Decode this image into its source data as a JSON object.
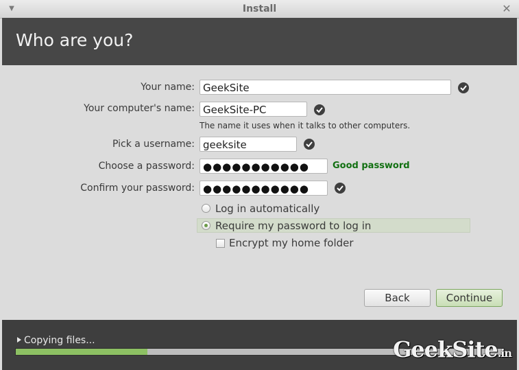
{
  "window": {
    "title": "Install"
  },
  "header": {
    "title": "Who are you?"
  },
  "form": {
    "name_label": "Your name:",
    "name_value": "GeekSite",
    "computer_label": "Your computer's name:",
    "computer_value": "GeekSite-PC",
    "computer_hint": "The name it uses when it talks to other computers.",
    "username_label": "Pick a username:",
    "username_value": "geeksite",
    "password_label": "Choose a password:",
    "password_value": "●●●●●●●●●●●",
    "password_strength": "Good password",
    "confirm_label": "Confirm your password:",
    "confirm_value": "●●●●●●●●●●●",
    "login_auto_label": "Log in automatically",
    "require_password_label": "Require my password to log in",
    "encrypt_label": "Encrypt my home folder",
    "selected_login_option": "require_password",
    "encrypt_checked": false
  },
  "buttons": {
    "back": "Back",
    "continue": "Continue"
  },
  "footer": {
    "status": "Copying files...",
    "progress": 0.27
  },
  "watermark": {
    "text": "GeekSite",
    "suffix": ".in"
  },
  "colors": {
    "header_bg": "#474747",
    "strength_green": "#127012",
    "progress_green": "#8dc063",
    "continue_green": "#c9deb6"
  },
  "icons": {
    "field_ok": "check-circle-icon",
    "window_menu": "chevron-down-icon",
    "window_close": "close-icon"
  }
}
